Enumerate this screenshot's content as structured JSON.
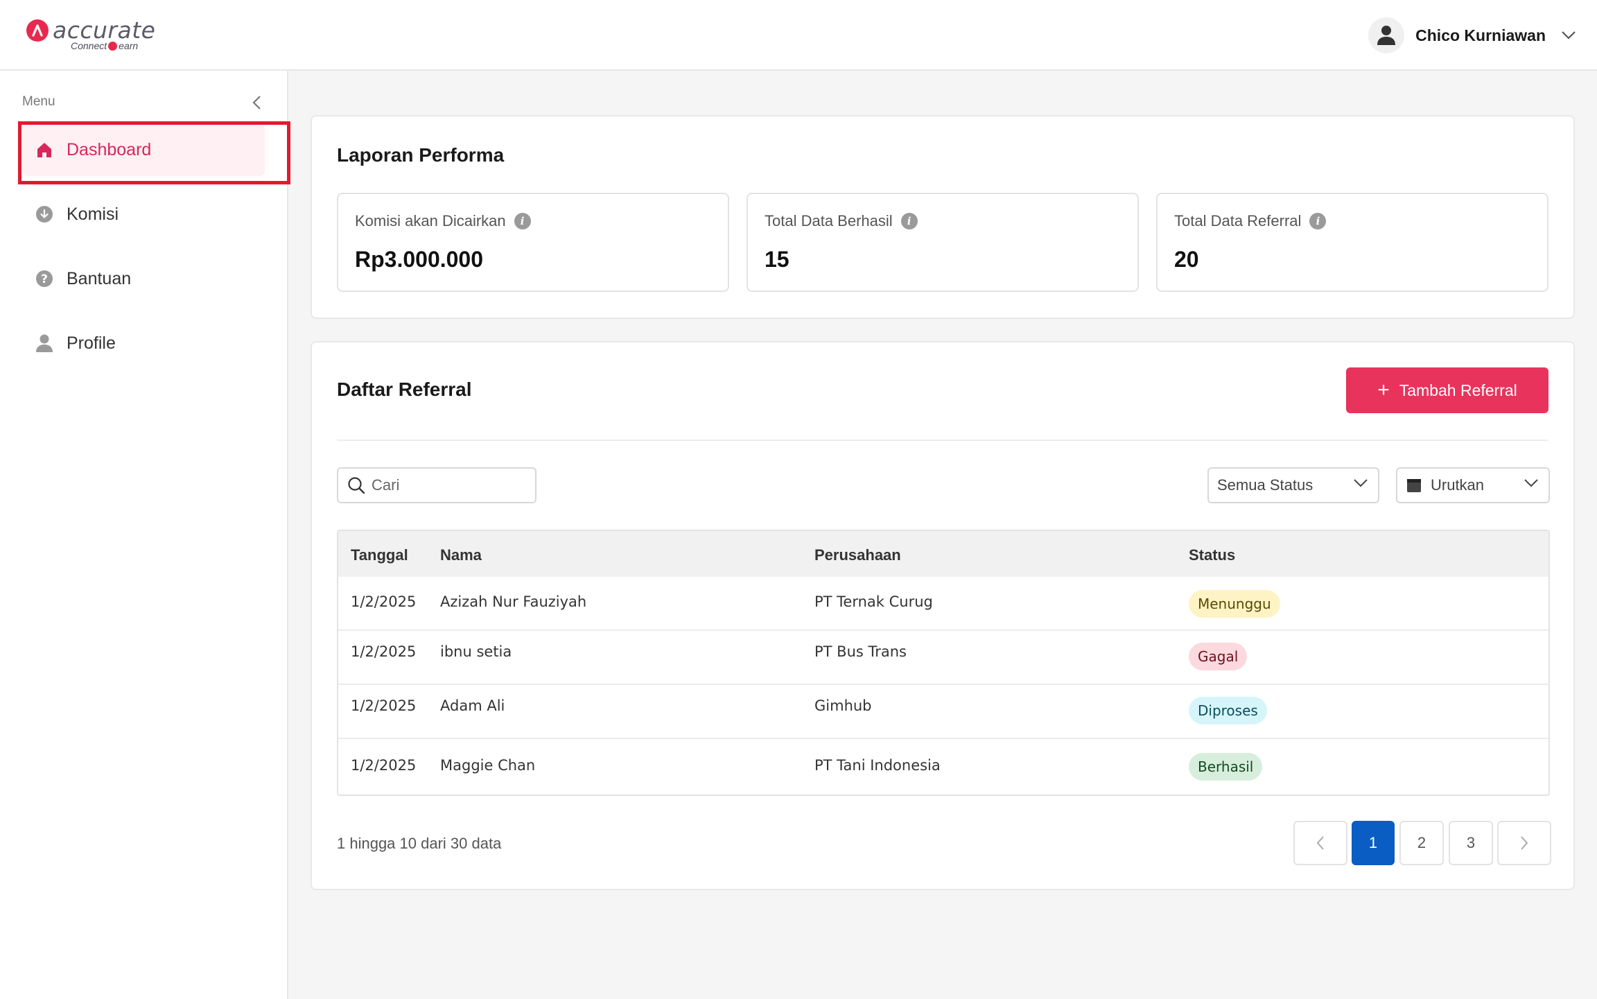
{
  "header": {
    "logo_word": "accurate",
    "logo_tag_left": "Connect",
    "logo_tag_right": "earn",
    "user_name": "Chico Kurniawan"
  },
  "sidebar": {
    "menu_label": "Menu",
    "items": [
      {
        "label": "Dashboard",
        "icon": "home-icon",
        "active": true
      },
      {
        "label": "Komisi",
        "icon": "download-circle-icon"
      },
      {
        "label": "Bantuan",
        "icon": "help-circle-icon"
      },
      {
        "label": "Profile",
        "icon": "user-icon"
      }
    ]
  },
  "performance": {
    "title": "Laporan Performa",
    "stats": [
      {
        "label": "Komisi akan Dicairkan",
        "value": "Rp3.000.000"
      },
      {
        "label": "Total Data Berhasil",
        "value": "15"
      },
      {
        "label": "Total Data Referral",
        "value": "20"
      }
    ]
  },
  "referrals": {
    "title": "Daftar Referral",
    "add_button": "Tambah Referral",
    "search_placeholder": "Cari",
    "status_filter": "Semua Status",
    "sort_label": "Urutkan",
    "columns": [
      "Tanggal",
      "Nama",
      "Perusahaan",
      "Status"
    ],
    "rows": [
      {
        "date": "1/2/2025",
        "name": "Azizah Nur Fauziyah",
        "company": "PT Ternak Curug",
        "status": "Menunggu"
      },
      {
        "date": "1/2/2025",
        "name": "ibnu setia",
        "company": "PT Bus Trans",
        "status": "Gagal"
      },
      {
        "date": "1/2/2025",
        "name": "Adam Ali",
        "company": "Gimhub",
        "status": "Diproses"
      },
      {
        "date": "1/2/2025",
        "name": "Maggie Chan",
        "company": "PT Tani Indonesia",
        "status": "Berhasil"
      }
    ],
    "range_text": "1 hingga 10 dari 30 data",
    "pages": [
      "1",
      "2",
      "3"
    ],
    "current_page": "1"
  },
  "colors": {
    "accent": "#e8335d",
    "pagination_active": "#0a5dc2",
    "badge_menunggu": "#fdf3c4",
    "badge_gagal": "#fbd9de",
    "badge_diproses": "#d6f5fa",
    "badge_berhasil": "#d7eedd"
  }
}
